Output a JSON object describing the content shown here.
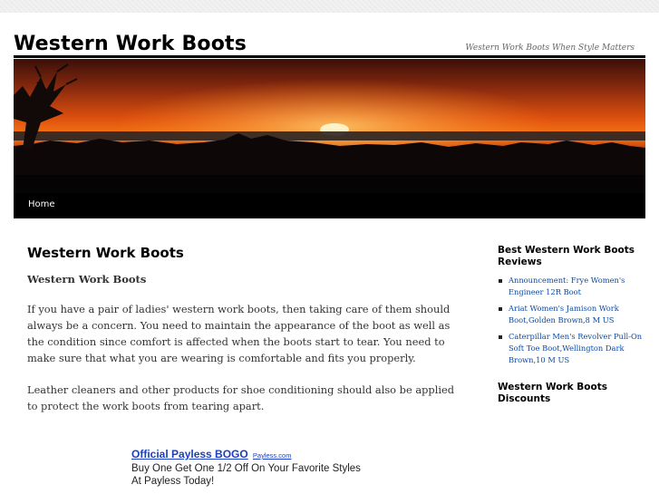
{
  "site": {
    "title": "Western Work Boots",
    "description": "Western Work Boots When Style Matters"
  },
  "menu": {
    "home": "Home"
  },
  "post": {
    "title": "Western Work Boots",
    "subtitle": "Western Work Boots",
    "paragraphs": [
      "If you have a pair of ladies' western work boots, then taking care of them should always be a concern. You need to maintain the appearance of the boot as well as the condition since comfort is affected when the boots start to tear. You need to make sure that what you are wearing is comfortable and fits you properly.",
      "Leather cleaners and other products for shoe conditioning should also be applied to protect the work boots from tearing apart."
    ]
  },
  "ad": {
    "title": "Official Payless BOGO",
    "url": "Payless.com",
    "text": "Buy One Get One 1/2 Off On Your Favorite Styles At Payless Today!"
  },
  "sidebar": {
    "widget1_title": "Best Western Work Boots Reviews",
    "items": [
      "Announcement: Frye Women's Engineer 12R Boot",
      "Ariat Women's Jamison Work Boot,Golden Brown,8 M US",
      "Caterpillar Men's Revolver Pull-On Soft Toe Boot,Wellington Dark Brown,10 M US"
    ],
    "widget2_title": "Western Work Boots Discounts"
  },
  "colors": {
    "link": "#0b4aa2",
    "ad_link": "#1a3fbf",
    "menu_bg": "#000000"
  }
}
